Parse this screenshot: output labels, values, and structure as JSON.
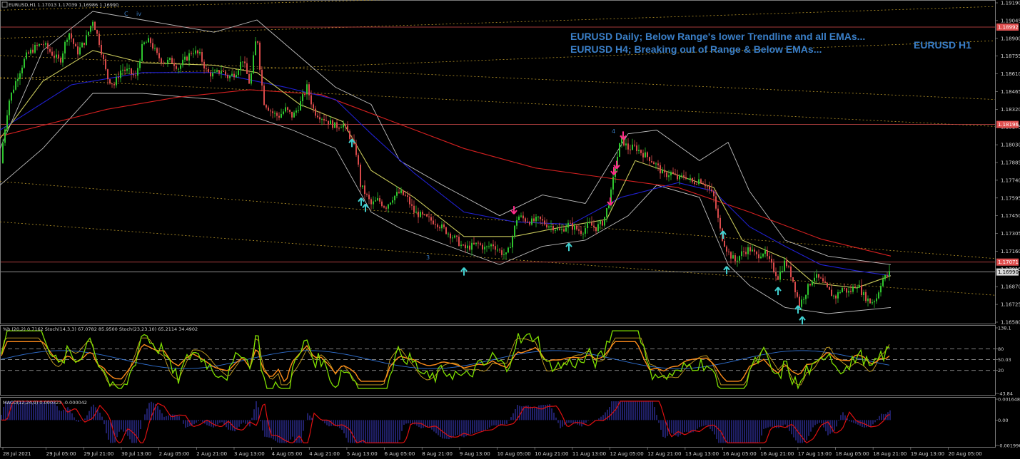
{
  "chart_data": [
    {
      "type": "candlestick",
      "title": "EURUSD,H1  1.17013 1.17039 1.16986 1.16990",
      "symbol": "EURUSD",
      "timeframe": "H1",
      "ohlc_last": {
        "open": 1.17013,
        "high": 1.17039,
        "low": 1.16986,
        "close": 1.1699
      },
      "ylim": [
        1.1658,
        1.1919
      ],
      "y_ticks": [
        "1.19190",
        "1.19045",
        "1.18900",
        "1.18755",
        "1.18610",
        "1.18465",
        "1.18320",
        "1.18175",
        "1.18030",
        "1.17885",
        "1.17740",
        "1.17595",
        "1.17450",
        "1.17305",
        "1.17160",
        "1.17015",
        "1.16870",
        "1.16725",
        "1.16580"
      ],
      "x_ticks": [
        "28 Jul 2021",
        "29 Jul 05:00",
        "29 Jul 21:00",
        "30 Jul 13:00",
        "2 Aug 05:00",
        "2 Aug 21:00",
        "3 Aug 13:00",
        "4 Aug 05:00",
        "4 Aug 21:00",
        "5 Aug 13:00",
        "6 Aug 05:00",
        "8 Aug 21:00",
        "9 Aug 13:00",
        "10 Aug 05:00",
        "10 Aug 21:00",
        "11 Aug 13:00",
        "12 Aug 05:00",
        "12 Aug 21:00",
        "13 Aug 13:00",
        "16 Aug 05:00",
        "16 Aug 21:00",
        "17 Aug 13:00",
        "18 Aug 05:00",
        "18 Aug 21:00",
        "19 Aug 13:00",
        "20 Aug 05:00"
      ],
      "price_levels": [
        {
          "label": "1.18992",
          "value": 1.18992,
          "color": "#e05050"
        },
        {
          "label": "1.18196",
          "value": 1.18196,
          "color": "#e05050"
        },
        {
          "label": "1.17071",
          "value": 1.17071,
          "color": "#e05050"
        },
        {
          "label": "1.16990",
          "value": 1.1699,
          "color": "#c0c0c0"
        }
      ],
      "annotations": [
        "EURUSD Daily; Below Range's lower Trendline and all EMAs...",
        "EURUSD H4; Breaking out of Range & Below EMAs...",
        "EURUSD H1"
      ],
      "wave_labels": [
        "C",
        "iv",
        "4",
        "3"
      ],
      "close_path": [
        [
          0,
          1.1788
        ],
        [
          12,
          1.1838
        ],
        [
          24,
          1.1858
        ],
        [
          36,
          1.1875
        ],
        [
          48,
          1.1882
        ],
        [
          60,
          1.1886
        ],
        [
          72,
          1.1878
        ],
        [
          84,
          1.1871
        ],
        [
          96,
          1.1896
        ],
        [
          108,
          1.1878
        ],
        [
          120,
          1.1889
        ],
        [
          130,
          1.1905
        ],
        [
          140,
          1.1885
        ],
        [
          150,
          1.1858
        ],
        [
          160,
          1.1852
        ],
        [
          170,
          1.1865
        ],
        [
          180,
          1.1863
        ],
        [
          190,
          1.1858
        ],
        [
          200,
          1.1885
        ],
        [
          210,
          1.1888
        ],
        [
          220,
          1.1876
        ],
        [
          230,
          1.187
        ],
        [
          240,
          1.1872
        ],
        [
          250,
          1.1866
        ],
        [
          260,
          1.1873
        ],
        [
          270,
          1.188
        ],
        [
          280,
          1.1876
        ],
        [
          290,
          1.1862
        ],
        [
          300,
          1.186
        ],
        [
          310,
          1.1864
        ],
        [
          320,
          1.1858
        ],
        [
          330,
          1.1862
        ],
        [
          340,
          1.1873
        ],
        [
          350,
          1.1852
        ],
        [
          360,
          1.1895
        ],
        [
          365,
          1.186
        ],
        [
          370,
          1.1838
        ],
        [
          380,
          1.183
        ],
        [
          390,
          1.1826
        ],
        [
          400,
          1.1832
        ],
        [
          410,
          1.1826
        ],
        [
          420,
          1.1836
        ],
        [
          430,
          1.185
        ],
        [
          440,
          1.183
        ],
        [
          450,
          1.1826
        ],
        [
          460,
          1.1822
        ],
        [
          470,
          1.1818
        ],
        [
          480,
          1.182
        ],
        [
          490,
          1.181
        ],
        [
          500,
          1.1795
        ],
        [
          505,
          1.177
        ],
        [
          510,
          1.1765
        ],
        [
          520,
          1.1754
        ],
        [
          530,
          1.1758
        ],
        [
          540,
          1.1752
        ],
        [
          550,
          1.176
        ],
        [
          560,
          1.1764
        ],
        [
          570,
          1.176
        ],
        [
          580,
          1.1748
        ],
        [
          590,
          1.1745
        ],
        [
          600,
          1.1742
        ],
        [
          610,
          1.174
        ],
        [
          620,
          1.1735
        ],
        [
          630,
          1.173
        ],
        [
          640,
          1.1725
        ],
        [
          650,
          1.1718
        ],
        [
          660,
          1.172
        ],
        [
          670,
          1.1722
        ],
        [
          680,
          1.1718
        ],
        [
          690,
          1.1722
        ],
        [
          700,
          1.1716
        ],
        [
          710,
          1.1712
        ],
        [
          718,
          1.1728
        ],
        [
          725,
          1.1745
        ],
        [
          735,
          1.1742
        ],
        [
          745,
          1.174
        ],
        [
          755,
          1.1742
        ],
        [
          765,
          1.1738
        ],
        [
          775,
          1.1736
        ],
        [
          785,
          1.1732
        ],
        [
          795,
          1.1738
        ],
        [
          805,
          1.1735
        ],
        [
          815,
          1.1732
        ],
        [
          825,
          1.1738
        ],
        [
          835,
          1.1735
        ],
        [
          845,
          1.174
        ],
        [
          855,
          1.176
        ],
        [
          862,
          1.1785
        ],
        [
          870,
          1.1808
        ],
        [
          880,
          1.18
        ],
        [
          890,
          1.1801
        ],
        [
          900,
          1.1796
        ],
        [
          910,
          1.1792
        ],
        [
          920,
          1.1786
        ],
        [
          930,
          1.1778
        ],
        [
          940,
          1.178
        ],
        [
          950,
          1.1775
        ],
        [
          960,
          1.1778
        ],
        [
          970,
          1.1772
        ],
        [
          980,
          1.1775
        ],
        [
          990,
          1.177
        ],
        [
          1000,
          1.176
        ],
        [
          1010,
          1.173
        ],
        [
          1020,
          1.1715
        ],
        [
          1030,
          1.1708
        ],
        [
          1040,
          1.1715
        ],
        [
          1050,
          1.1718
        ],
        [
          1060,
          1.1712
        ],
        [
          1070,
          1.1716
        ],
        [
          1080,
          1.1705
        ],
        [
          1090,
          1.1695
        ],
        [
          1100,
          1.1708
        ],
        [
          1110,
          1.1694
        ],
        [
          1120,
          1.1672
        ],
        [
          1130,
          1.1684
        ],
        [
          1140,
          1.1696
        ],
        [
          1150,
          1.1692
        ],
        [
          1160,
          1.1684
        ],
        [
          1170,
          1.1678
        ],
        [
          1180,
          1.1686
        ],
        [
          1190,
          1.1682
        ],
        [
          1200,
          1.169
        ],
        [
          1210,
          1.168
        ],
        [
          1220,
          1.1674
        ],
        [
          1228,
          1.1678
        ],
        [
          1235,
          1.1692
        ],
        [
          1248,
          1.1699
        ]
      ],
      "ema_series": [
        {
          "color": "#d42020",
          "path": [
            [
              0,
              1.181
            ],
            [
              150,
              1.1832
            ],
            [
              250,
              1.1842
            ],
            [
              350,
              1.1848
            ],
            [
              450,
              1.1844
            ],
            [
              550,
              1.1822
            ],
            [
              650,
              1.18
            ],
            [
              750,
              1.1784
            ],
            [
              850,
              1.1776
            ],
            [
              950,
              1.1768
            ],
            [
              1050,
              1.1748
            ],
            [
              1150,
              1.1726
            ],
            [
              1248,
              1.1712
            ]
          ]
        },
        {
          "color": "#2020d0",
          "path": [
            [
              0,
              1.1815
            ],
            [
              100,
              1.1852
            ],
            [
              200,
              1.1862
            ],
            [
              300,
              1.1862
            ],
            [
              400,
              1.185
            ],
            [
              470,
              1.184
            ],
            [
              520,
              1.1812
            ],
            [
              580,
              1.178
            ],
            [
              650,
              1.1748
            ],
            [
              720,
              1.174
            ],
            [
              800,
              1.1738
            ],
            [
              870,
              1.176
            ],
            [
              950,
              1.1772
            ],
            [
              1000,
              1.1765
            ],
            [
              1050,
              1.1736
            ],
            [
              1100,
              1.172
            ],
            [
              1150,
              1.1705
            ],
            [
              1200,
              1.17
            ],
            [
              1248,
              1.1696
            ]
          ]
        },
        {
          "color": "#c8c85a",
          "path": [
            [
              0,
              1.1808
            ],
            [
              60,
              1.1855
            ],
            [
              130,
              1.188
            ],
            [
              200,
              1.187
            ],
            [
              300,
              1.1868
            ],
            [
              360,
              1.1862
            ],
            [
              420,
              1.1836
            ],
            [
              480,
              1.1822
            ],
            [
              520,
              1.1782
            ],
            [
              580,
              1.176
            ],
            [
              650,
              1.1728
            ],
            [
              720,
              1.1728
            ],
            [
              790,
              1.1736
            ],
            [
              850,
              1.1742
            ],
            [
              890,
              1.179
            ],
            [
              950,
              1.1778
            ],
            [
              1000,
              1.1768
            ],
            [
              1040,
              1.1725
            ],
            [
              1100,
              1.171
            ],
            [
              1140,
              1.169
            ],
            [
              1200,
              1.1686
            ],
            [
              1248,
              1.1696
            ]
          ]
        }
      ],
      "bollinger": {
        "upper": [
          [
            0,
            1.18
          ],
          [
            60,
            1.188
          ],
          [
            130,
            1.1912
          ],
          [
            200,
            1.1905
          ],
          [
            300,
            1.1895
          ],
          [
            360,
            1.1905
          ],
          [
            410,
            1.188
          ],
          [
            470,
            1.185
          ],
          [
            520,
            1.1836
          ],
          [
            560,
            1.179
          ],
          [
            620,
            1.177
          ],
          [
            700,
            1.1745
          ],
          [
            760,
            1.1762
          ],
          [
            820,
            1.1755
          ],
          [
            880,
            1.1812
          ],
          [
            920,
            1.1815
          ],
          [
            980,
            1.179
          ],
          [
            1020,
            1.1805
          ],
          [
            1050,
            1.1765
          ],
          [
            1100,
            1.1725
          ],
          [
            1160,
            1.1712
          ],
          [
            1248,
            1.1705
          ]
        ],
        "lower": [
          [
            0,
            1.177
          ],
          [
            60,
            1.18
          ],
          [
            130,
            1.1845
          ],
          [
            200,
            1.1845
          ],
          [
            300,
            1.184
          ],
          [
            360,
            1.1825
          ],
          [
            410,
            1.1815
          ],
          [
            470,
            1.18
          ],
          [
            520,
            1.1748
          ],
          [
            560,
            1.1735
          ],
          [
            620,
            1.1722
          ],
          [
            700,
            1.1705
          ],
          [
            760,
            1.172
          ],
          [
            820,
            1.1725
          ],
          [
            880,
            1.1745
          ],
          [
            920,
            1.177
          ],
          [
            980,
            1.176
          ],
          [
            1020,
            1.1705
          ],
          [
            1050,
            1.1688
          ],
          [
            1100,
            1.167
          ],
          [
            1160,
            1.1665
          ],
          [
            1248,
            1.167
          ]
        ]
      },
      "arrows": [
        {
          "x": 493,
          "y": 1.1804,
          "dir": "up",
          "color": "#40d0d0"
        },
        {
          "x": 506,
          "y": 1.1756,
          "dir": "up",
          "color": "#40d0d0"
        },
        {
          "x": 512,
          "y": 1.1751,
          "dir": "up",
          "color": "#40d0d0"
        },
        {
          "x": 650,
          "y": 1.1699,
          "dir": "up",
          "color": "#40d0d0"
        },
        {
          "x": 797,
          "y": 1.1719,
          "dir": "up",
          "color": "#40d0d0"
        },
        {
          "x": 1013,
          "y": 1.1729,
          "dir": "up",
          "color": "#40d0d0"
        },
        {
          "x": 1018,
          "y": 1.17,
          "dir": "up",
          "color": "#40d0d0"
        },
        {
          "x": 1090,
          "y": 1.1683,
          "dir": "up",
          "color": "#40d0d0"
        },
        {
          "x": 1118,
          "y": 1.1668,
          "dir": "up",
          "color": "#40d0d0"
        },
        {
          "x": 1124,
          "y": 1.1659,
          "dir": "up",
          "color": "#40d0d0"
        },
        {
          "x": 720,
          "y": 1.175,
          "dir": "down",
          "color": "#ff2a8a"
        },
        {
          "x": 855,
          "y": 1.1757,
          "dir": "down",
          "color": "#ff2a8a"
        },
        {
          "x": 860,
          "y": 1.1782,
          "dir": "down",
          "color": "#ff2a8a"
        },
        {
          "x": 864,
          "y": 1.1787,
          "dir": "down",
          "color": "#ff2a8a"
        },
        {
          "x": 873,
          "y": 1.1811,
          "dir": "down",
          "color": "#ff2a8a"
        }
      ]
    },
    {
      "type": "line",
      "title": "%b (20,2) 0.7162 Stoch(14,3,3) 67.0782 85.9500 Stoch(23,23,10) 65.2114 34.4902",
      "ylim": [
        -43.84,
        138.1
      ],
      "y_ticks": [
        "138.1",
        "80",
        "50.03",
        "20",
        "-43.84"
      ],
      "series": [
        {
          "name": "%b (20,2)",
          "color": "#7fe000"
        },
        {
          "name": "Stoch(14,3,3)",
          "color": "#c8a020"
        },
        {
          "name": "Stoch(23,23,10)",
          "color": "#ff8c1a"
        }
      ]
    },
    {
      "type": "bar",
      "title": "MACD(12,24,9) 0.000323 -0.000042",
      "ylim": [
        -0.001996,
        0.001648
      ],
      "y_ticks": [
        "0.001648",
        "0.00",
        "-0.001996"
      ],
      "series": [
        {
          "name": "MACD(12,24,9)",
          "color": "#4040d0"
        },
        {
          "name": "Signal",
          "color": "#e01010"
        }
      ]
    }
  ]
}
